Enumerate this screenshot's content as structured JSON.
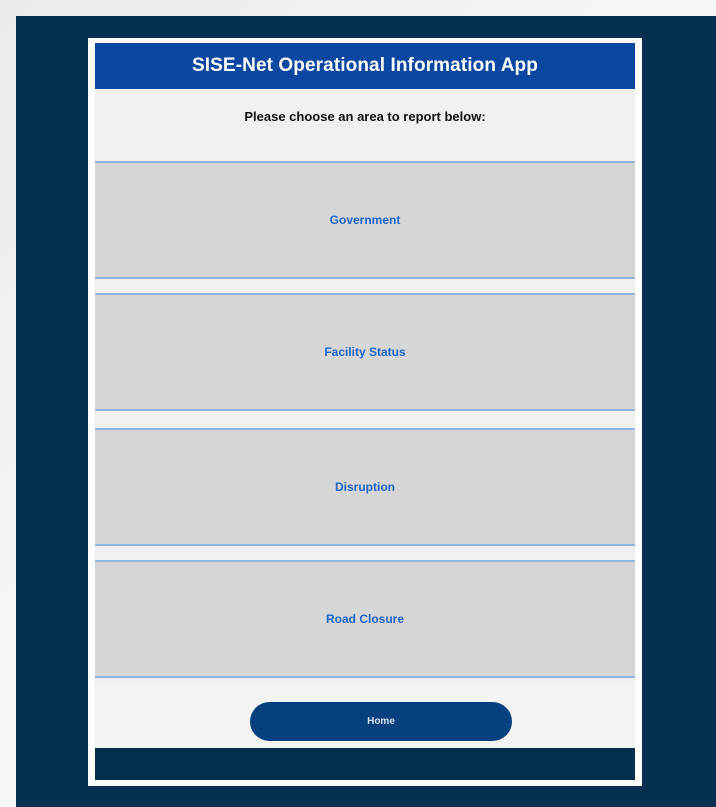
{
  "header": {
    "title": "SISE-Net Operational Information App"
  },
  "prompt": {
    "text": "Please choose an area to report below:"
  },
  "menu": {
    "items": [
      {
        "label": "Government"
      },
      {
        "label": "Facility Status"
      },
      {
        "label": "Disruption"
      },
      {
        "label": "Road Closure"
      }
    ]
  },
  "home": {
    "label": "Home"
  },
  "colors": {
    "header_bg": "#0a47a0",
    "frame_bg": "#05304f",
    "button_bg": "#d5d6d7",
    "button_text": "#1e63c8",
    "home_button_bg": "#07407e"
  }
}
